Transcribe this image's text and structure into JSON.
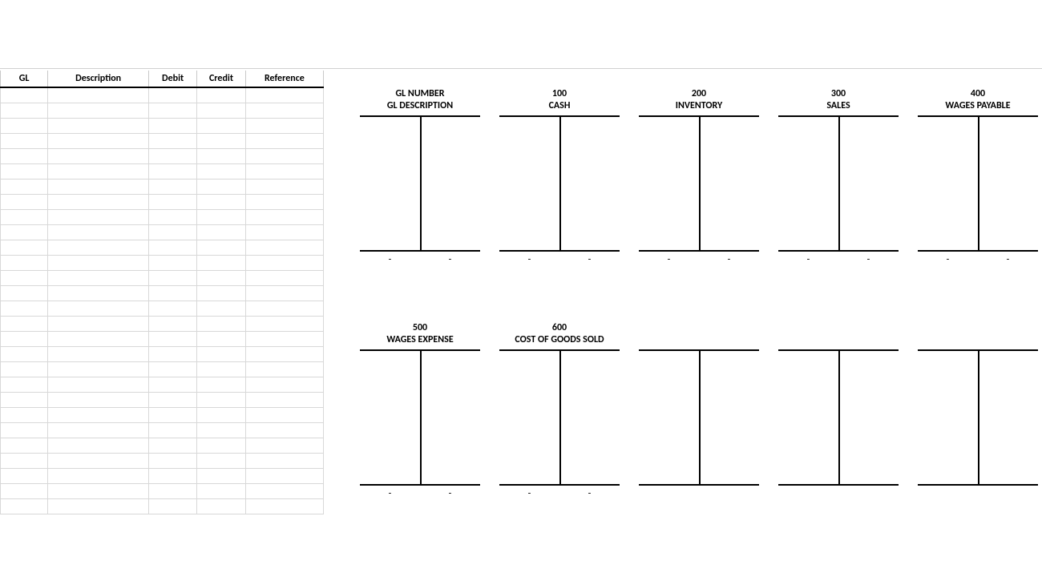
{
  "journal": {
    "headers": {
      "gl": "GL",
      "desc": "Description",
      "debit": "Debit",
      "credit": "Credit",
      "ref": "Reference"
    },
    "row_count": 28
  },
  "t_accounts": {
    "row1": [
      {
        "number": "GL NUMBER",
        "name": "GL DESCRIPTION",
        "footer_left": "-",
        "footer_right": "-",
        "has_footer": true
      },
      {
        "number": "100",
        "name": "CASH",
        "footer_left": "-",
        "footer_right": "-",
        "has_footer": true
      },
      {
        "number": "200",
        "name": "INVENTORY",
        "footer_left": "-",
        "footer_right": "-",
        "has_footer": true
      },
      {
        "number": "300",
        "name": "SALES",
        "footer_left": "-",
        "footer_right": "-",
        "has_footer": true
      },
      {
        "number": "400",
        "name": "WAGES PAYABLE",
        "footer_left": "-",
        "footer_right": "-",
        "has_footer": true
      }
    ],
    "row2": [
      {
        "number": "500",
        "name": "WAGES EXPENSE",
        "footer_left": "-",
        "footer_right": "-",
        "has_footer": true
      },
      {
        "number": "600",
        "name": "COST OF GOODS SOLD",
        "footer_left": "-",
        "footer_right": "-",
        "has_footer": true
      },
      {
        "number": "",
        "name": "",
        "footer_left": "",
        "footer_right": "",
        "has_footer": false
      },
      {
        "number": "",
        "name": "",
        "footer_left": "",
        "footer_right": "",
        "has_footer": false
      },
      {
        "number": "",
        "name": "",
        "footer_left": "",
        "footer_right": "",
        "has_footer": false
      }
    ]
  }
}
